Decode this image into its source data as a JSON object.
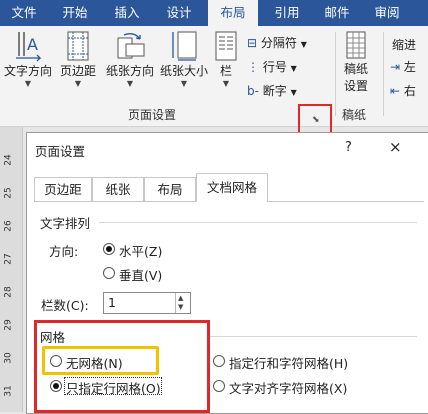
{
  "ribbon_tabs": [
    "文件",
    "开始",
    "插入",
    "设计",
    "布局",
    "引用",
    "邮件",
    "审阅"
  ],
  "ribbon_active_tab": "布局",
  "ribbon": {
    "text_direction": "文字方向",
    "margins": "页边距",
    "orientation": "纸张方向",
    "paper_size": "纸张大小",
    "columns": "栏",
    "breaks": "分隔符",
    "line_numbers": "行号",
    "hyphenation": "断字",
    "page_setup_group": "页面设置",
    "manuscript_line1": "稿纸",
    "manuscript_line2": "设置",
    "manuscript_group": "稿纸",
    "indent": "缩进",
    "indent_left": "左",
    "indent_right": "右"
  },
  "ruler_numbers": [
    "24",
    "25",
    "26",
    "27",
    "28",
    "29",
    "30",
    "31"
  ],
  "dialog": {
    "title": "页面设置",
    "help": "?",
    "close": "×",
    "tabs": [
      "页边距",
      "纸张",
      "布局",
      "文档网格"
    ],
    "active_tab": "文档网格",
    "text_arrangement": "文字排列",
    "direction_label": "方向:",
    "horizontal": "水平(Z)",
    "vertical": "垂直(V)",
    "columns_label": "栏数(C):",
    "columns_value": "1",
    "grid_label": "网格",
    "no_grid": "无网格(N)",
    "lines_and_chars": "指定行和字符网格(H)",
    "lines_only": "只指定行网格(O)",
    "snap_chars": "文字对齐字符网格(X)",
    "selected_direction": "水平(Z)",
    "selected_grid": "只指定行网格(O)"
  },
  "colors": {
    "ribbon_blue": "#2b579a",
    "highlight_red": "#e12828",
    "highlight_yellow": "#f2c200"
  }
}
